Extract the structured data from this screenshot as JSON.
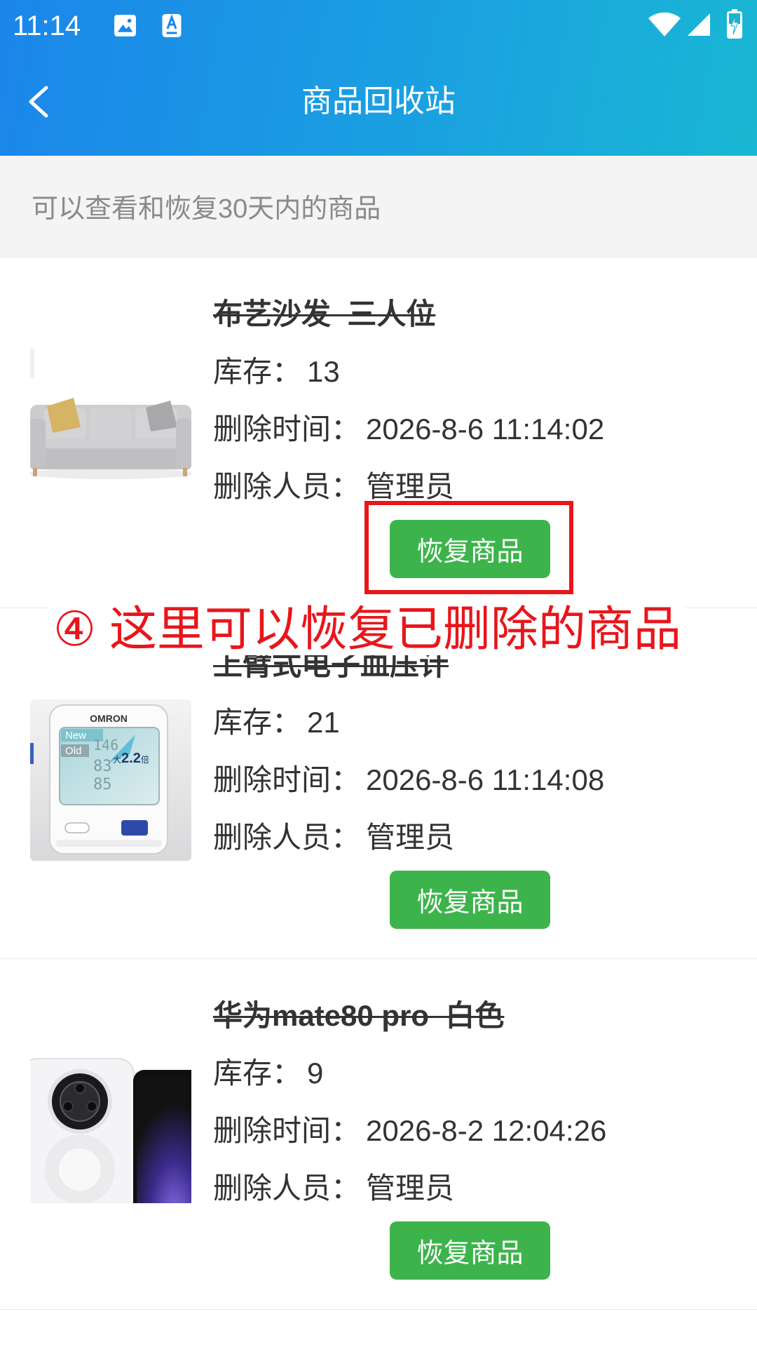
{
  "status_bar": {
    "time": "11:14",
    "icons": [
      "gallery-icon",
      "app-notification-icon",
      "wifi-icon",
      "signal-icon",
      "battery-charging-icon"
    ]
  },
  "header": {
    "back_icon": "chevron-left-icon",
    "title": "商品回收站"
  },
  "notice": {
    "text": "可以查看和恢复30天内的商品"
  },
  "labels": {
    "stock": "库存：",
    "delete_time": "删除时间：",
    "deleted_by": "删除人员："
  },
  "items": [
    {
      "title": "布艺沙发  三人位",
      "stock": "13",
      "delete_time": "2026-8-6 11:14:02",
      "deleted_by": "管理员",
      "restore_label": "恢复商品",
      "thumbnail": "sofa-image"
    },
    {
      "title": "上臂式电子血压计",
      "stock": "21",
      "delete_time": "2026-8-6 11:14:08",
      "deleted_by": "管理员",
      "restore_label": "恢复商品",
      "thumbnail": "blood-pressure-monitor-image",
      "thumbnail_text": {
        "brand": "OMRON",
        "new": "New",
        "old": "Old",
        "badge_prefix": "大",
        "badge_value": "2.2",
        "badge_suffix": "倍",
        "reading_top": "146",
        "reading_mid": "83",
        "reading_low": "85"
      }
    },
    {
      "title": "华为mate80 pro  白色",
      "stock": "9",
      "delete_time": "2026-8-2 12:04:26",
      "deleted_by": "管理员",
      "restore_label": "恢复商品",
      "thumbnail": "smartphone-image"
    }
  ],
  "annotation": {
    "text": "④ 这里可以恢复已删除的商品",
    "target": "restore-product-button"
  },
  "colors": {
    "header_gradient": [
      "#1b86ea",
      "#19b7d3"
    ],
    "restore_button": "#3cb44b",
    "annotation": "#e8161b",
    "notice_background": "#f4f4f4",
    "notice_text": "#8a8a8a"
  }
}
